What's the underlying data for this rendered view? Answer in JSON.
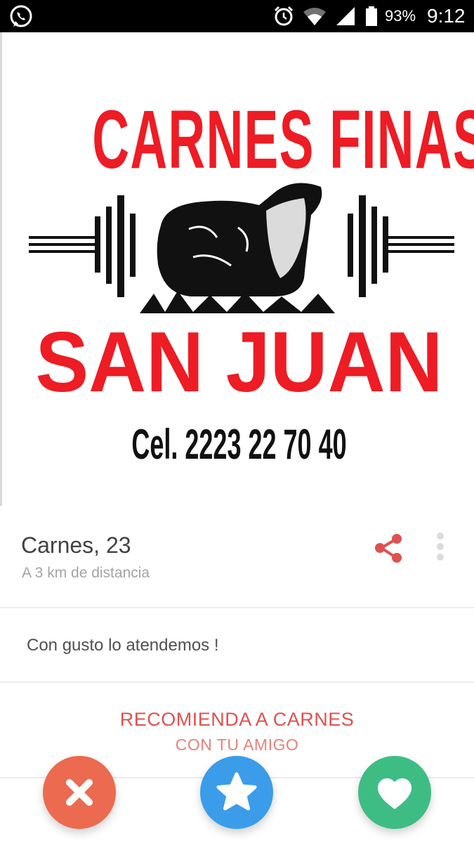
{
  "status_bar": {
    "battery": "93%",
    "time": "9:12",
    "icons": [
      "whatsapp-icon",
      "alarm-icon",
      "wifi-icon",
      "signal-icon",
      "battery-icon"
    ]
  },
  "photo": {
    "logo_top_text": "CARNES FINAS",
    "logo_bottom_text": "SAN JUAN",
    "logo_phone": "Cel. 2223 22 70 40",
    "logo_color": "#ee1c24"
  },
  "profile": {
    "name": "Carnes,",
    "age": "23",
    "distance": "A 3 km de distancia",
    "share_icon": "share-icon",
    "more_icon": "more-vertical-icon",
    "accent": "#e0514f"
  },
  "bio": "Con gusto lo atendemos !",
  "recommend": {
    "title": "RECOMIENDA A CARNES",
    "subtitle": "CON TU AMIGO"
  },
  "actions": [
    {
      "icon": "close-icon",
      "color": "#ec6a4f"
    },
    {
      "icon": "star-icon",
      "color": "#3b9de9"
    },
    {
      "icon": "heart-icon",
      "color": "#3dbd84"
    }
  ]
}
